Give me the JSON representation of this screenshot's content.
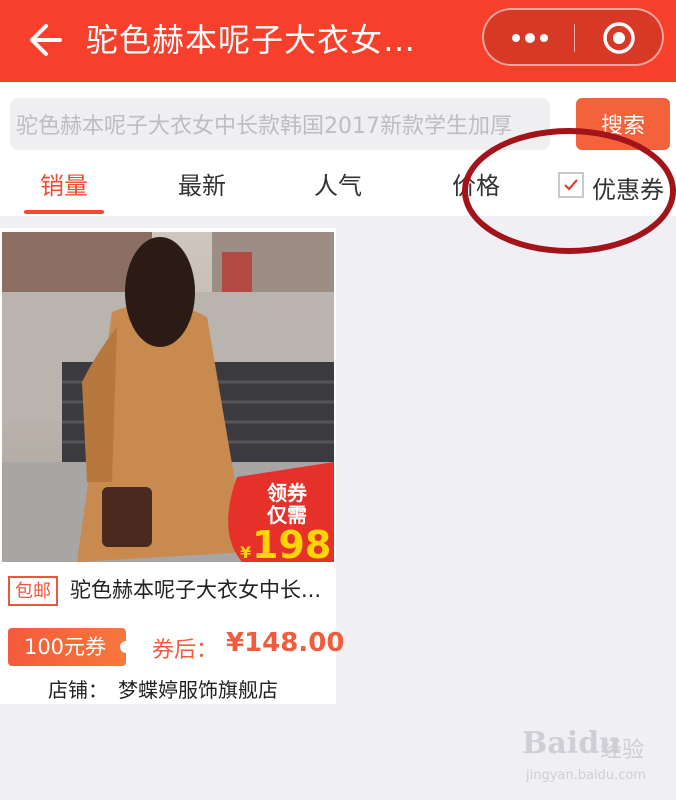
{
  "header": {
    "title": "驼色赫本呢子大衣女…",
    "back_icon": "back-arrow-icon",
    "more_icon": "more-dots-icon",
    "close_icon": "target-circle-icon",
    "bg_color": "#f6402c"
  },
  "search": {
    "value": "驼色赫本呢子大衣女中长款韩国2017新款学生加厚",
    "button_label": "搜索"
  },
  "tabs": [
    {
      "label": "销量",
      "active": true
    },
    {
      "label": "最新",
      "active": false
    },
    {
      "label": "人气",
      "active": false
    },
    {
      "label": "价格",
      "active": false
    }
  ],
  "coupon_filter": {
    "label": "优惠券",
    "checked": true
  },
  "product": {
    "mail_tag": "包邮",
    "title": "驼色赫本呢子大衣女中长...",
    "image_badge": {
      "line1": "领券",
      "line2": "仅需",
      "currency": "¥",
      "price": "198"
    },
    "coupon_badge": "100元券",
    "price_label": "券后：",
    "price_value": "¥148.00",
    "shop_label": "店铺：",
    "shop_name": "梦蝶婷服饰旗舰店"
  },
  "watermark": {
    "brand": "Baidu",
    "brand2": "经验",
    "url": "jingyan.baidu.com"
  },
  "accent_color": "#f54a32"
}
